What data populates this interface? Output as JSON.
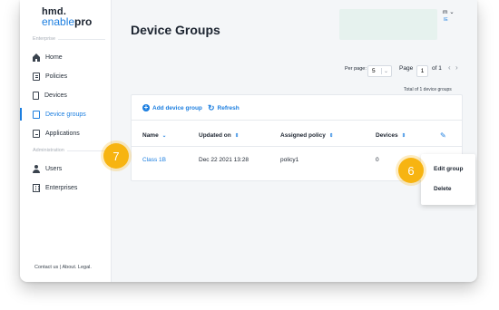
{
  "brand": {
    "line1": "hmd.",
    "line2_prefix": "enable",
    "line2_suffix": "pro"
  },
  "sidebar": {
    "section_enterprise": "Enterprise",
    "section_admin": "Administration",
    "items": [
      {
        "label": "Home",
        "icon": "home-icon"
      },
      {
        "label": "Policies",
        "icon": "policy-icon"
      },
      {
        "label": "Devices",
        "icon": "phone-icon"
      },
      {
        "label": "Device groups",
        "icon": "device-group-icon",
        "active": true
      },
      {
        "label": "Applications",
        "icon": "applications-icon"
      },
      {
        "label": "Users",
        "icon": "user-icon"
      },
      {
        "label": "Enterprises",
        "icon": "building-icon"
      }
    ],
    "footer": "Contact us | About. Legal."
  },
  "header": {
    "title": "Device Groups",
    "user_name": "m",
    "user_sub": "IE"
  },
  "pagination": {
    "per_page_label": "Per page:",
    "per_page_value": "5",
    "page_label": "Page",
    "page_value": "1",
    "of_label": "of 1",
    "total": "Total of 1 device groups"
  },
  "toolbar": {
    "add_label": "Add device group",
    "refresh_label": "Refresh"
  },
  "table": {
    "columns": [
      "Name",
      "Updated on",
      "Assigned policy",
      "Devices"
    ],
    "rows": [
      {
        "name": "Class 1B",
        "updated": "Dec 22 2021 13:28",
        "policy": "policy1",
        "devices": "0"
      }
    ]
  },
  "context_menu": {
    "edit": "Edit group",
    "delete": "Delete"
  },
  "callouts": {
    "left": "7",
    "right": "6"
  },
  "colors": {
    "accent": "#1d7fe0",
    "callout": "#f7b411",
    "text": "#1c2430"
  }
}
